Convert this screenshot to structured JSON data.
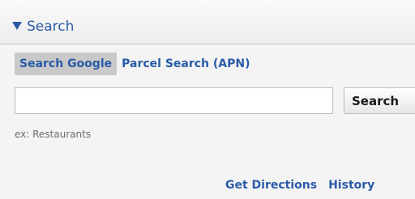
{
  "panel": {
    "title": "Search"
  },
  "tabs": [
    {
      "label": "Search Google",
      "active": true
    },
    {
      "label": "Parcel Search (APN)",
      "active": false
    }
  ],
  "search": {
    "value": "",
    "placeholder": "",
    "button_label": "Search",
    "hint": "ex: Restaurants"
  },
  "links": {
    "directions": "Get Directions",
    "history": "History"
  },
  "colors": {
    "link": "#2a5ba7",
    "active_tab_bg": "#c9c9c9",
    "panel_bg": "#f4f4f4"
  },
  "icons": {
    "toggle": "triangle-down-icon"
  }
}
